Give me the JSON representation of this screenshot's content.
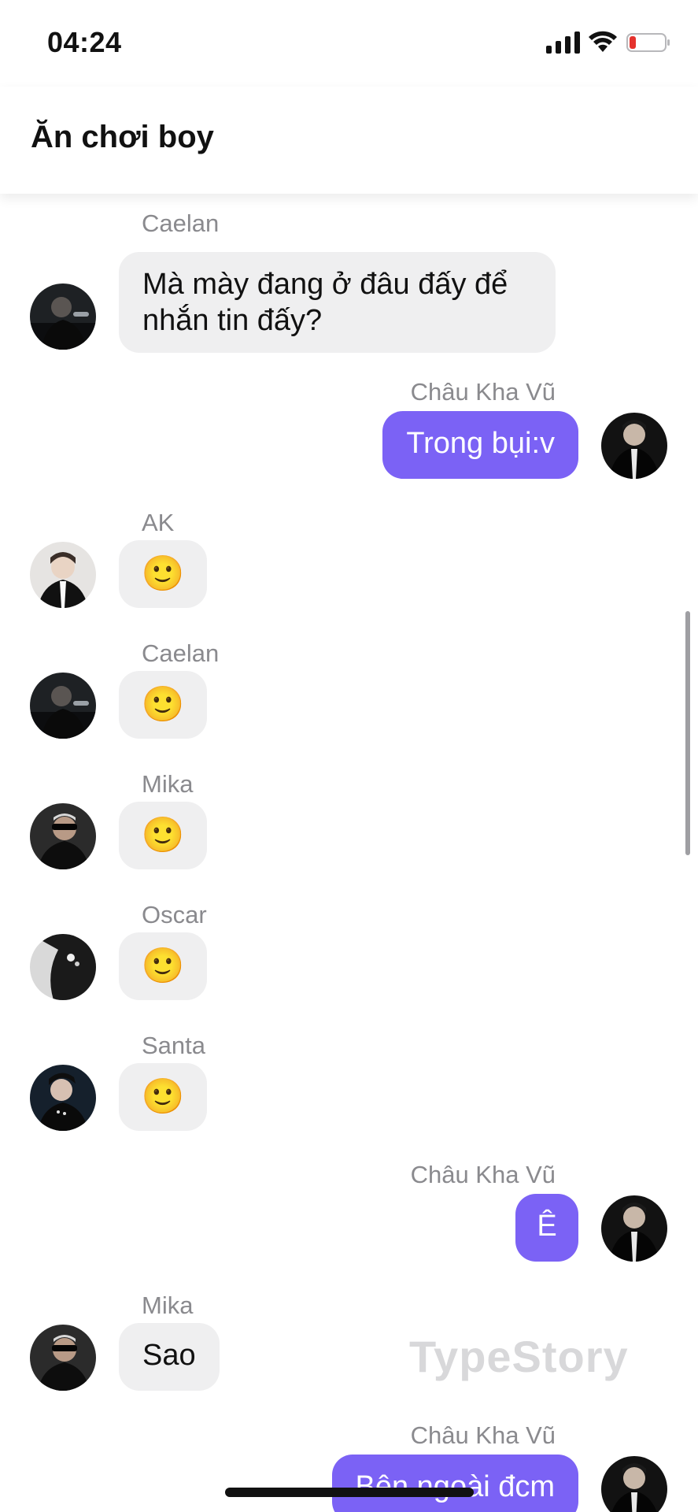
{
  "status_bar": {
    "time": "04:24",
    "icons": [
      "signal-icon",
      "wifi-icon",
      "battery-low-icon"
    ],
    "battery_color": "#e5322d"
  },
  "header": {
    "title": "Ăn chơi boy"
  },
  "colors": {
    "outgoing_bubble": "#7b62f5",
    "incoming_bubble": "#efeff0",
    "sender_text": "#8a8a8e"
  },
  "messages": [
    {
      "sender": "Caelan",
      "direction": "in",
      "text": "Mà mày đang ở đâu đấy để nhắn tin đấy?"
    },
    {
      "sender": "Châu Kha Vũ",
      "direction": "out",
      "text": "Trong bụi:v"
    },
    {
      "sender": "AK",
      "direction": "in",
      "text": "🙂"
    },
    {
      "sender": "Caelan",
      "direction": "in",
      "text": "🙂"
    },
    {
      "sender": "Mika",
      "direction": "in",
      "text": "🙂"
    },
    {
      "sender": "Oscar",
      "direction": "in",
      "text": "🙂"
    },
    {
      "sender": "Santa",
      "direction": "in",
      "text": "🙂"
    },
    {
      "sender": "Châu Kha Vũ",
      "direction": "out",
      "text": "Ê"
    },
    {
      "sender": "Mika",
      "direction": "in",
      "text": "Sao"
    },
    {
      "sender": "Châu Kha Vũ",
      "direction": "out",
      "text": "Bên ngoài đcm"
    }
  ],
  "watermark": "TypeStory"
}
